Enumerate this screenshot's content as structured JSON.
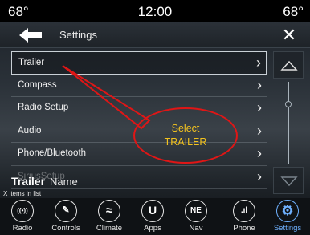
{
  "status_bar": {
    "temp_left": "68°",
    "clock": "12:00",
    "temp_right": "68°"
  },
  "header": {
    "title": "Settings",
    "back_icon": "back-arrow-icon",
    "close_label": "✕"
  },
  "list": {
    "items": [
      {
        "label": "Trailer",
        "selected": true
      },
      {
        "label": "Compass"
      },
      {
        "label": "Radio Setup"
      },
      {
        "label": "Audio"
      },
      {
        "label": "Phone/Bluetooth"
      },
      {
        "label": "SiriusSetup"
      }
    ],
    "chevron": "›"
  },
  "footer": {
    "status_bold": "Trailer",
    "status_sub": "Name",
    "count_text": "X items in list"
  },
  "callout": {
    "line1": "Select",
    "line2": "TRAILER",
    "color": "#e01616",
    "text_color": "#f2c21f"
  },
  "dock": {
    "items": [
      {
        "label": "Radio",
        "icon": "radio-icon",
        "glyph": "((•))"
      },
      {
        "label": "Controls",
        "icon": "controls-icon",
        "glyph": "✎"
      },
      {
        "label": "Climate",
        "icon": "climate-icon",
        "glyph": "≈"
      },
      {
        "label": "Apps",
        "icon": "apps-icon",
        "glyph": "U"
      },
      {
        "label": "Nav",
        "icon": "nav-icon",
        "glyph": "NE"
      },
      {
        "label": "Phone",
        "icon": "phone-icon",
        "glyph": ".ıl"
      },
      {
        "label": "Settings",
        "icon": "settings-icon",
        "glyph": "⚙",
        "active": true
      }
    ],
    "accent": "#6fb1ff"
  }
}
